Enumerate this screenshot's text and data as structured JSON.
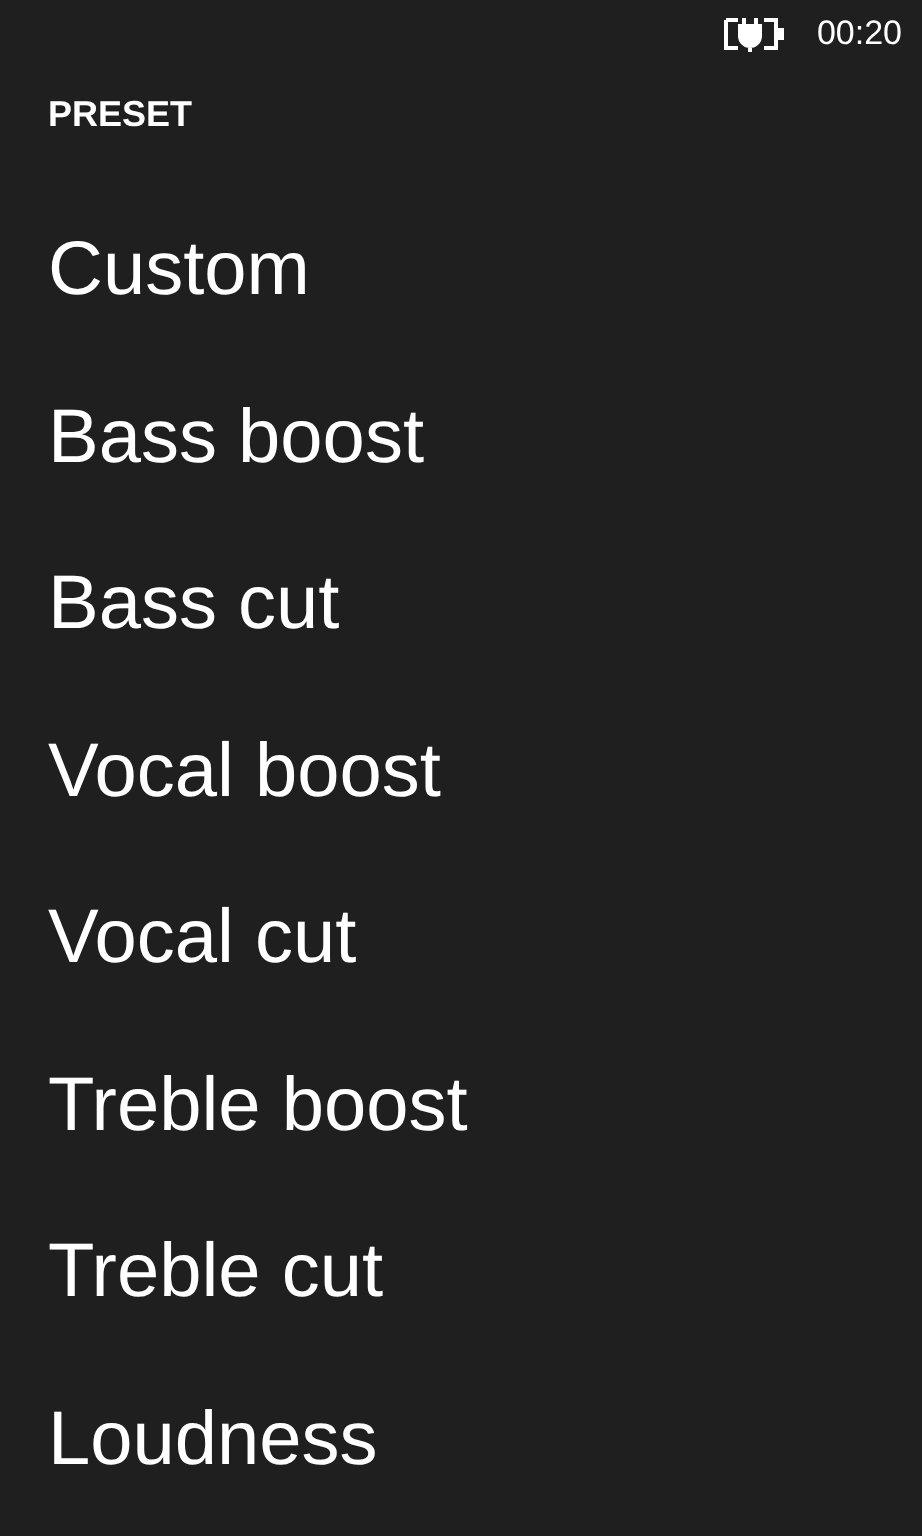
{
  "status_bar": {
    "time": "00:20"
  },
  "header": "PRESET",
  "presets": [
    "Custom",
    "Bass boost",
    "Bass cut",
    "Vocal boost",
    "Vocal cut",
    "Treble boost",
    "Treble cut",
    "Loudness"
  ]
}
